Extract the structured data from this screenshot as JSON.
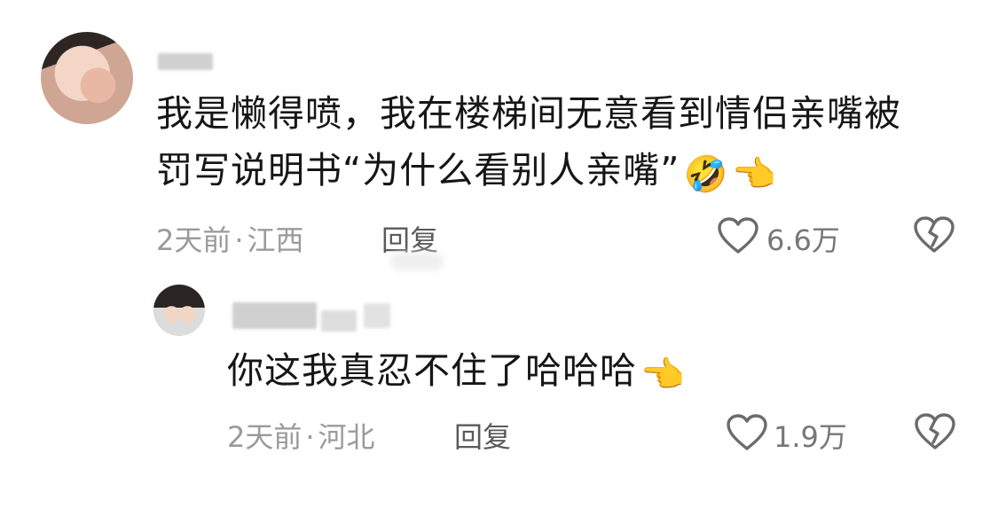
{
  "comments": [
    {
      "text_line1": "我是懒得喷，我在楼梯间无意看到情侣亲嘴被",
      "text_line2": "罚写说明书“为什么看别人亲嘴”",
      "emoji1": "🤣",
      "emoji2": "👈",
      "time": "2天前",
      "sep": "·",
      "location": "江西",
      "reply_label": "回复",
      "likes": "6.6万"
    },
    {
      "text": "你这我真忍不住了哈哈哈",
      "emoji": "👈",
      "time": "2天前",
      "sep": "·",
      "location": "河北",
      "reply_label": "回复",
      "likes": "1.9万"
    }
  ],
  "icons": {
    "like": "heart-outline-icon",
    "dislike": "broken-heart-icon"
  },
  "colors": {
    "text": "#161616",
    "meta": "#9a9a9a",
    "icon": "#6b6b6b"
  }
}
